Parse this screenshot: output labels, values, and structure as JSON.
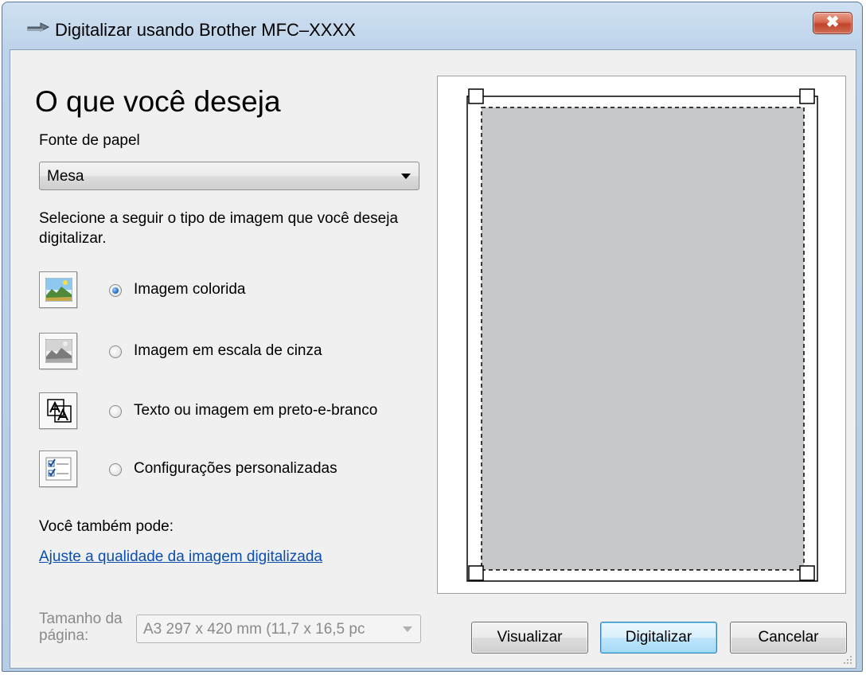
{
  "window": {
    "title": "Digitalizar usando Brother MFC–XXXX",
    "close_label": "✖"
  },
  "main": {
    "heading": "O que você deseja",
    "paper_source_label": "Fonte de papel",
    "paper_source_value": "Mesa",
    "description": "Selecione a seguir o tipo de imagem que você deseja digitalizar.",
    "options": [
      {
        "label": "Imagem colorida",
        "icon": "color-photo-icon",
        "selected": true
      },
      {
        "label": "Imagem em escala de cinza",
        "icon": "grayscale-photo-icon",
        "selected": false
      },
      {
        "label": "Texto ou imagem em preto-e-branco",
        "icon": "black-white-text-icon",
        "selected": false
      },
      {
        "label": "Configurações personalizadas",
        "icon": "custom-settings-icon",
        "selected": false
      }
    ],
    "also_label": "Você também pode:",
    "adjust_link": "Ajuste a qualidade da imagem digitalizada",
    "page_size_label": "Tamanho da página:",
    "page_size_value": "A3 297 x 420 mm (11,7 x 16,5 pc"
  },
  "buttons": {
    "preview": "Visualizar",
    "scan": "Digitalizar",
    "cancel": "Cancelar"
  },
  "colors": {
    "title_gradient": "#bdd3ea",
    "close_button": "#c2432a",
    "link": "#0a4eb0",
    "preview_area": "#c6c7c9",
    "default_button": "#bee6fd"
  }
}
